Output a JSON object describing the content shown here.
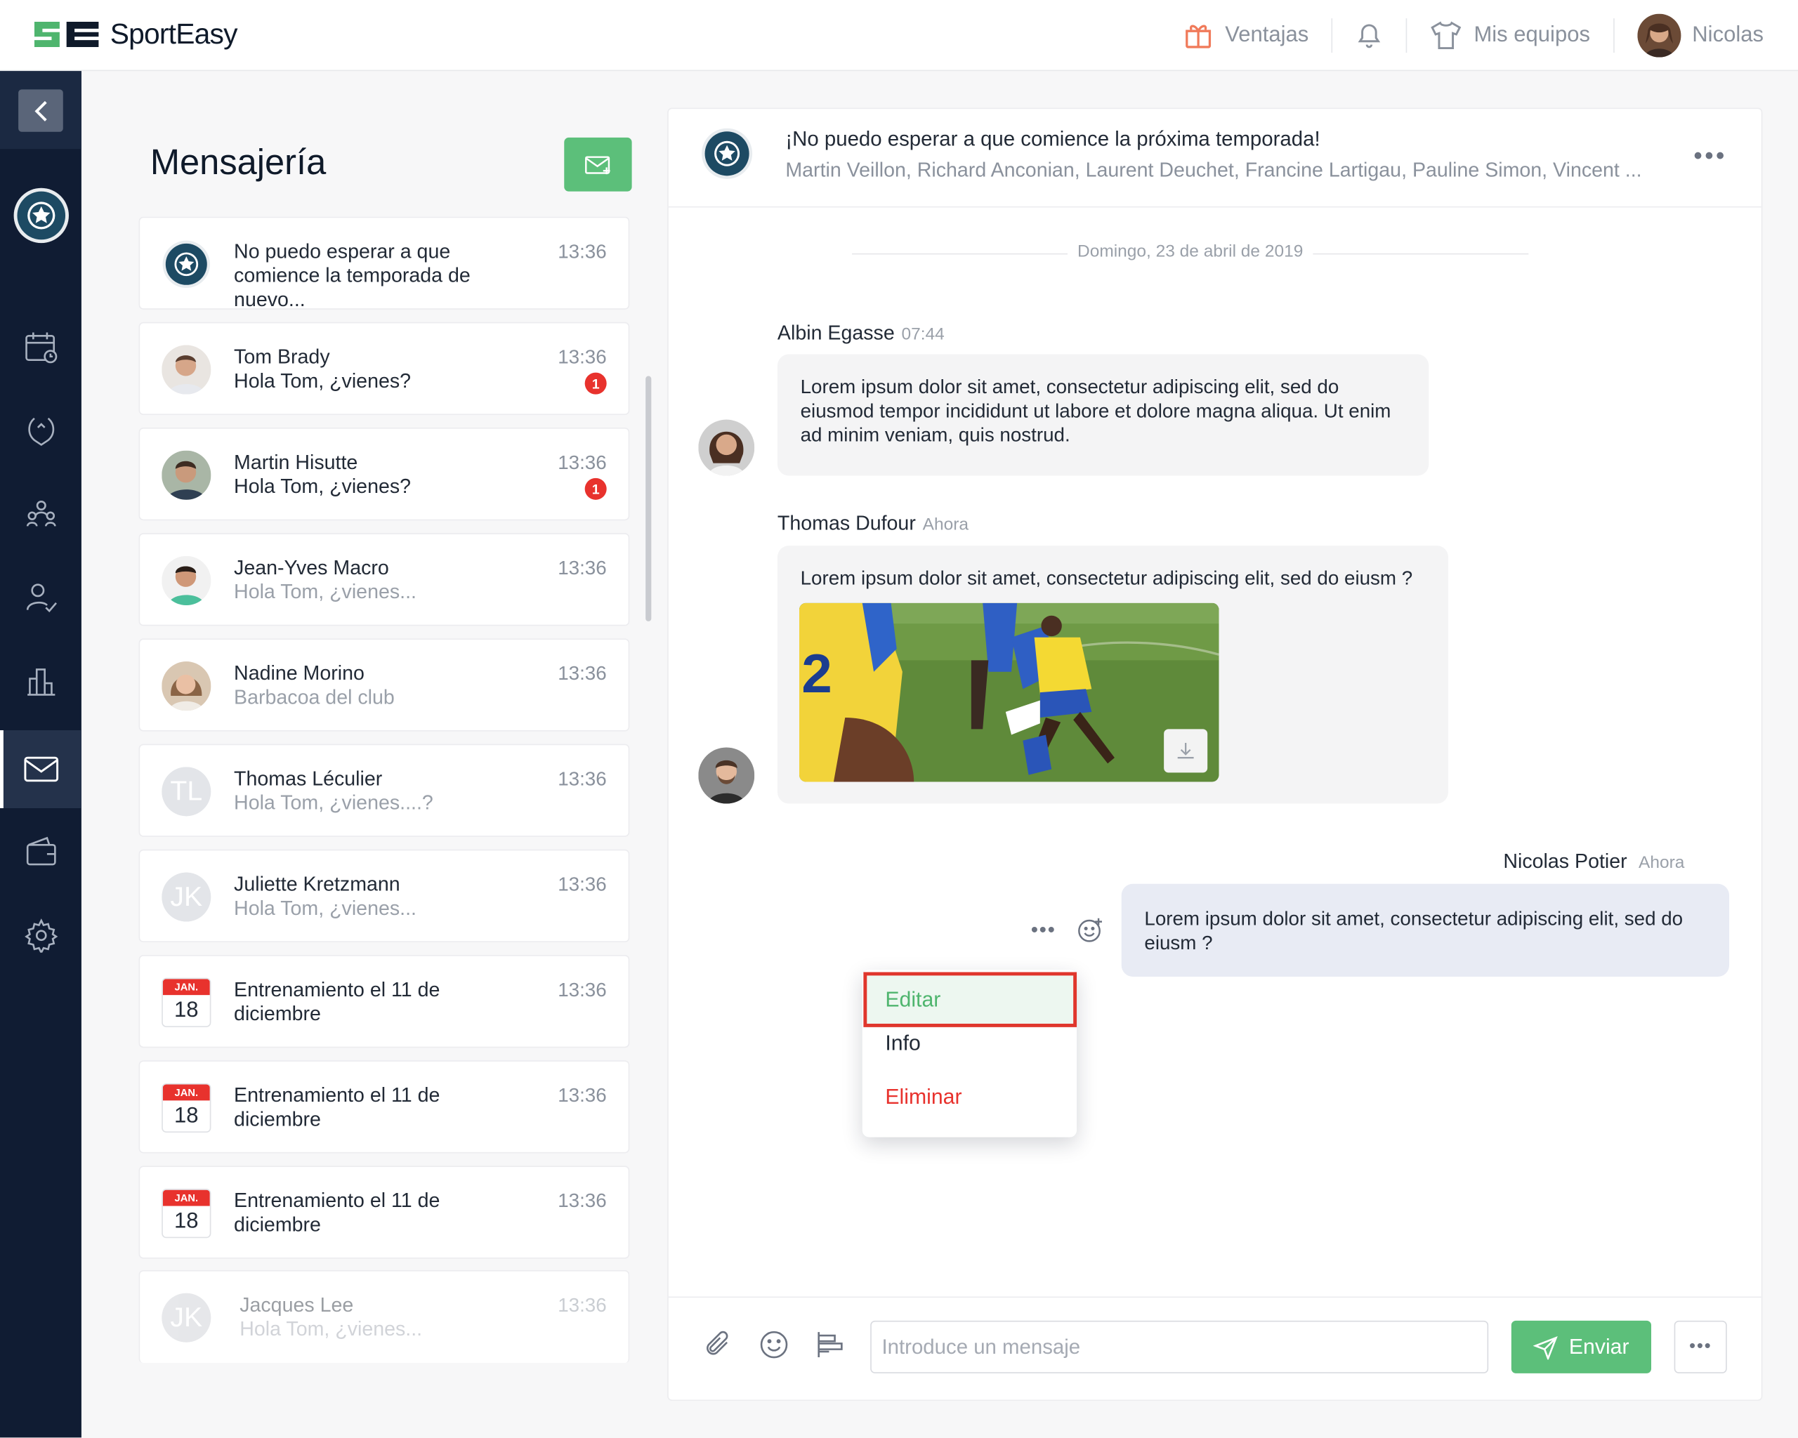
{
  "app": {
    "name": "SportEasy"
  },
  "topbar": {
    "advantages_label": "Ventajas",
    "teams_label": "Mis equipos",
    "user_name": "Nicolas"
  },
  "sidebar": {
    "icons": [
      "back-arrow-icon",
      "club-logo",
      "calendar-icon",
      "trophy-icon",
      "team-icon",
      "member-check-icon",
      "stats-icon",
      "mail-icon",
      "wallet-icon",
      "settings-icon"
    ],
    "active": "mail"
  },
  "messaging": {
    "title": "Mensajería",
    "conversations": [
      {
        "line1": "No puedo esperar a que comience la temporada de nuevo...",
        "line2": "",
        "time": "13:36",
        "badge": "",
        "avatar": "club"
      },
      {
        "line1": "Tom Brady",
        "line2": "Hola Tom, ¿vienes?",
        "time": "13:36",
        "badge": "1",
        "avatar": "photo"
      },
      {
        "line1": "Martin Hisutte",
        "line2": "Hola Tom, ¿vienes?",
        "time": "13:36",
        "badge": "1",
        "avatar": "photo"
      },
      {
        "line1": "Jean-Yves Macro",
        "line2": "Hola Tom, ¿vienes...",
        "time": "13:36",
        "badge": "",
        "avatar": "photo"
      },
      {
        "line1": "Nadine Morino",
        "line2": "Barbacoa del club",
        "time": "13:36",
        "badge": "",
        "avatar": "photo"
      },
      {
        "line1": "Thomas Léculier",
        "line2": "Hola Tom, ¿vienes....?",
        "time": "13:36",
        "badge": "",
        "avatar": "initials",
        "initials": "TL"
      },
      {
        "line1": "Juliette Kretzmann",
        "line2": "Hola Tom, ¿vienes...",
        "time": "13:36",
        "badge": "",
        "avatar": "initials",
        "initials": "JK"
      },
      {
        "line1": "Entrenamiento el 11 de diciembre",
        "line2": "",
        "time": "13:36",
        "avatar": "calendar",
        "cal_month": "JAN.",
        "cal_day": "18"
      },
      {
        "line1": "Entrenamiento el 11 de diciembre",
        "line2": "",
        "time": "13:36",
        "avatar": "calendar",
        "cal_month": "JAN.",
        "cal_day": "18"
      },
      {
        "line1": "Entrenamiento el 11 de diciembre",
        "line2": "",
        "time": "13:36",
        "avatar": "calendar",
        "cal_month": "JAN.",
        "cal_day": "18"
      },
      {
        "line1": "Jacques Lee",
        "line2": "Hola Tom, ¿vienes...",
        "time": "13:36",
        "avatar": "initials",
        "initials": "JK"
      }
    ]
  },
  "chat": {
    "title": "¡No puedo esperar a que comience la próxima temporada!",
    "members": "Martin Veillon, Richard Anconian, Laurent Deuchet, Francine Lartigau, Pauline Simon, Vincent ...",
    "date_separator": "Domingo, 23 de abril de 2019",
    "messages": [
      {
        "author": "Albin Egasse",
        "time": "07:44",
        "text": "Lorem ipsum dolor sit amet, consectetur adipiscing elit, sed do eiusmod tempor incididunt ut labore et dolore magna aliqua. Ut enim ad minim veniam, quis nostrud."
      },
      {
        "author": "Thomas Dufour",
        "time": "Ahora",
        "text": "Lorem ipsum dolor sit amet, consectetur adipiscing elit, sed do eiusm ?"
      },
      {
        "author": "Nicolas Potier",
        "time": "Ahora",
        "text": "Lorem ipsum dolor sit amet, consectetur adipiscing elit, sed do eiusm ?"
      }
    ],
    "context_menu": {
      "edit": "Editar",
      "info": "Info",
      "delete": "Eliminar"
    },
    "composer": {
      "placeholder": "Introduce un mensaje",
      "send_label": "Enviar"
    }
  },
  "colors": {
    "accent": "#5cbf7a",
    "sidebar": "#101c33",
    "danger": "#e8322d"
  }
}
